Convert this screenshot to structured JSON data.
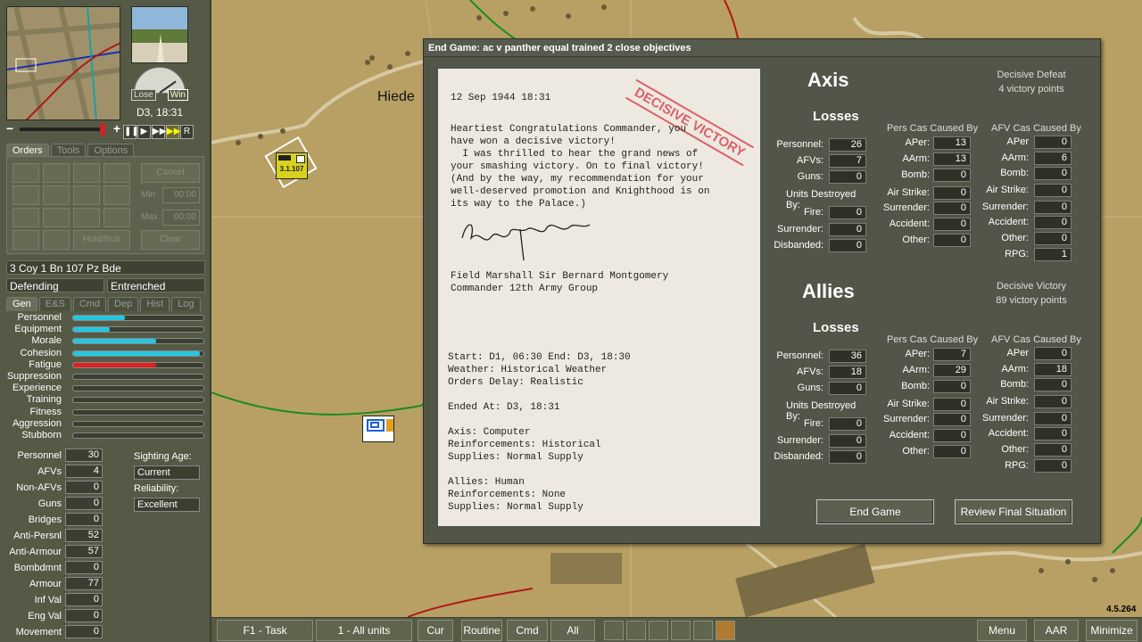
{
  "map": {
    "place_label": "Hiede",
    "unit_counter_label": "3.1.107"
  },
  "left_panel": {
    "datetime": "D3, 18:31",
    "dial": {
      "lose": "Lose",
      "win": "Win"
    },
    "speed_buttons": [
      "❚❚",
      "▶",
      "▶▶",
      "▶▶▶",
      "R"
    ],
    "main_tabs": [
      "Orders",
      "Tools",
      "Options"
    ],
    "orders": {
      "cancel_label": "Cancel",
      "hold_label": "Hold/Run",
      "clear_label": "Clear",
      "min_label": "Min",
      "max_label": "Max",
      "min_value": "00:00",
      "max_value": "00:00"
    },
    "unit_name": "3 Coy 1 Bn 107 Pz Bde",
    "posture": "Defending",
    "deployment": "Entrenched",
    "info_tabs": [
      "Gen",
      "E&S",
      "Cmd",
      "Dep",
      "Hist",
      "Log"
    ],
    "bars": [
      {
        "label": "Personnel",
        "value": 0.4,
        "color": "#26c6e0"
      },
      {
        "label": "Equipment",
        "value": 0.28,
        "color": "#26c6e0"
      },
      {
        "label": "Morale",
        "value": 0.64,
        "color": "#26c6e0"
      },
      {
        "label": "Cohesion",
        "value": 0.97,
        "color": "#26c6e0"
      },
      {
        "label": "Fatigue",
        "value": 0.64,
        "color": "#e02020"
      },
      {
        "label": "Suppression",
        "value": 0,
        "color": "#26c6e0"
      },
      {
        "label": "Experience",
        "value": 0,
        "color": "#26c6e0"
      },
      {
        "label": "Training",
        "value": 0,
        "color": "#26c6e0"
      },
      {
        "label": "Fitness",
        "value": 0,
        "color": "#26c6e0"
      },
      {
        "label": "Aggression",
        "value": 0,
        "color": "#26c6e0"
      },
      {
        "label": "Stubborn",
        "value": 0,
        "color": "#26c6e0"
      }
    ],
    "stats": [
      {
        "label": "Personnel",
        "value": "30"
      },
      {
        "label": "AFVs",
        "value": "4"
      },
      {
        "label": "Non-AFVs",
        "value": "0"
      },
      {
        "label": "Guns",
        "value": "0"
      },
      {
        "label": "Bridges",
        "value": "0"
      },
      {
        "label": "Anti-Persnl",
        "value": "52"
      },
      {
        "label": "Anti-Armour",
        "value": "57"
      },
      {
        "label": "Bombdmnt",
        "value": "0"
      },
      {
        "label": "Armour",
        "value": "77"
      },
      {
        "label": "Inf Val",
        "value": "0"
      },
      {
        "label": "Eng Val",
        "value": "0"
      },
      {
        "label": "Movement",
        "value": "0"
      }
    ],
    "sighting_age_label": "Sighting Age:",
    "sighting_age_value": "Current",
    "reliability_label": "Reliability:",
    "reliability_value": "Excellent"
  },
  "bottom_bar": {
    "task": "F1 - Task",
    "units": "1 - All units",
    "cur": "Cur",
    "routine": "Routine",
    "cmd": "Cmd",
    "all": "All",
    "menu": "Menu",
    "aar": "AAR",
    "minimize": "Minimize",
    "version": "4.5.264"
  },
  "dialog": {
    "title": "End Game: ac  v panther equal trained 2 close objectives",
    "letter": {
      "date": "12 Sep 1944 18:31",
      "stamp": "DECISIVE VICTORY",
      "body": "Heartiest Congratulations Commander, you\nhave won a decisive victory!\n  I was thrilled to hear the grand news of\nyour smashing victory. On to final victory!\n(And by the way, my recommendation for your\nwell-deserved promotion and Knighthood is on\nits way to the Palace.)",
      "sign_line1": "Field Marshall Sir Bernard Montgomery",
      "sign_line2": "Commander 12th Army Group",
      "summary": "Start: D1, 06:30 End: D3, 18:30\nWeather: Historical Weather\nOrders Delay: Realistic\n\nEnded At: D3, 18:31\n\nAxis: Computer\nReinforcements: Historical\nSupplies: Normal Supply\n\nAllies: Human\nReinforcements: None\nSupplies: Normal Supply"
    },
    "axis": {
      "title": "Axis",
      "result": "Decisive Defeat",
      "points": "4 victory points",
      "losses_title": "Losses",
      "personnel": "26",
      "afvs": "7",
      "guns": "0",
      "units_destroyed_title": "Units Destroyed By:",
      "fire": "0",
      "surrender": "0",
      "disbanded": "0",
      "pers_title": "Pers Cas Caused By",
      "pers": {
        "aper": "13",
        "aarm": "13",
        "bomb": "0",
        "air": "0",
        "surrender": "0",
        "accident": "0",
        "other": "0"
      },
      "afv_title": "AFV Cas Caused By",
      "afv": {
        "aper": "0",
        "aarm": "6",
        "bomb": "0",
        "air": "0",
        "surrender": "0",
        "accident": "0",
        "other": "0",
        "rpg": "1"
      }
    },
    "allies": {
      "title": "Allies",
      "result": "Decisive Victory",
      "points": "89 victory points",
      "losses_title": "Losses",
      "personnel": "36",
      "afvs": "18",
      "guns": "0",
      "units_destroyed_title": "Units Destroyed By:",
      "fire": "0",
      "surrender": "0",
      "disbanded": "0",
      "pers_title": "Pers Cas Caused By",
      "pers": {
        "aper": "7",
        "aarm": "29",
        "bomb": "0",
        "air": "0",
        "surrender": "0",
        "accident": "0",
        "other": "0"
      },
      "afv_title": "AFV Cas Caused By",
      "afv": {
        "aper": "0",
        "aarm": "18",
        "bomb": "0",
        "air": "0",
        "surrender": "0",
        "accident": "0",
        "other": "0",
        "rpg": "0"
      }
    },
    "labels": {
      "personnel": "Personnel:",
      "afvs": "AFVs:",
      "guns": "Guns:",
      "fire": "Fire:",
      "surrender": "Surrender:",
      "disbanded": "Disbanded:",
      "aper": "APer:",
      "aarm": "AArm:",
      "bomb": "Bomb:",
      "air": "Air Strike:",
      "accident": "Accident:",
      "other": "Other:",
      "rpg": "RPG:",
      "aper_afv": "APer",
      "aarm_afv": "AArm:"
    },
    "end_game_button": "End Game",
    "review_button": "Review Final Situation"
  }
}
